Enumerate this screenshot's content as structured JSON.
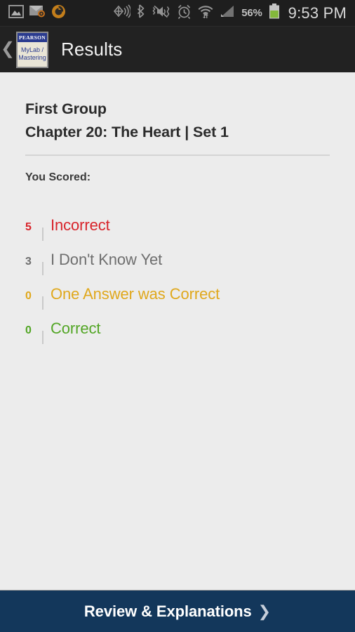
{
  "status_bar": {
    "notification_icons": [
      {
        "name": "gallery-image-icon",
        "label": "Gallery"
      },
      {
        "name": "email-icon",
        "label": "Email"
      },
      {
        "name": "sync-circle-icon",
        "label": "Sync"
      }
    ],
    "system_icons": [
      {
        "name": "nfc-beam-icon",
        "label": "NFC"
      },
      {
        "name": "bluetooth-icon",
        "label": "Bluetooth"
      },
      {
        "name": "mute-vibrate-icon",
        "label": "Sound off / vibrate"
      },
      {
        "name": "alarm-clock-icon",
        "label": "Alarm"
      },
      {
        "name": "wifi-icon",
        "label": "Wi-Fi"
      },
      {
        "name": "cell-signal-icon",
        "label": "Cellular signal"
      }
    ],
    "battery_percent": "56%",
    "battery_level": 56,
    "clock": "9:53 PM"
  },
  "app_bar": {
    "back_label": "❮",
    "logo": {
      "top_text": "PEARSON",
      "line1": "MyLab /",
      "line2": "Mastering"
    },
    "title": "Results"
  },
  "main": {
    "group_title": "First Group",
    "assignment_title": "Chapter 20: The Heart | Set 1",
    "scored_label": "You Scored:",
    "scores": [
      {
        "count": "5",
        "label": "Incorrect",
        "color": "#D8232A",
        "name": "score-row-incorrect"
      },
      {
        "count": "3",
        "label": "I Don't Know Yet",
        "color": "#6E6E6E",
        "name": "score-row-i-dont-know-yet"
      },
      {
        "count": "0",
        "label": "One Answer was Correct",
        "color": "#E0A81C",
        "name": "score-row-one-answer-was-correct"
      },
      {
        "count": "0",
        "label": "Correct",
        "color": "#53A626",
        "name": "score-row-correct"
      }
    ]
  },
  "bottom_bar": {
    "label": "Review & Explanations",
    "arrow": "❯"
  },
  "colors": {
    "status_bar_bg": "#1E1E1E",
    "app_bar_bg": "#222222",
    "content_bg": "#ECECEC",
    "bottom_bar_bg": "#13375B",
    "brand_blue": "#2A3B8F",
    "incorrect_red": "#D8232A",
    "unknown_gray": "#6E6E6E",
    "partial_amber": "#E0A81C",
    "correct_green": "#53A626",
    "battery_green": "#8CC63E"
  }
}
